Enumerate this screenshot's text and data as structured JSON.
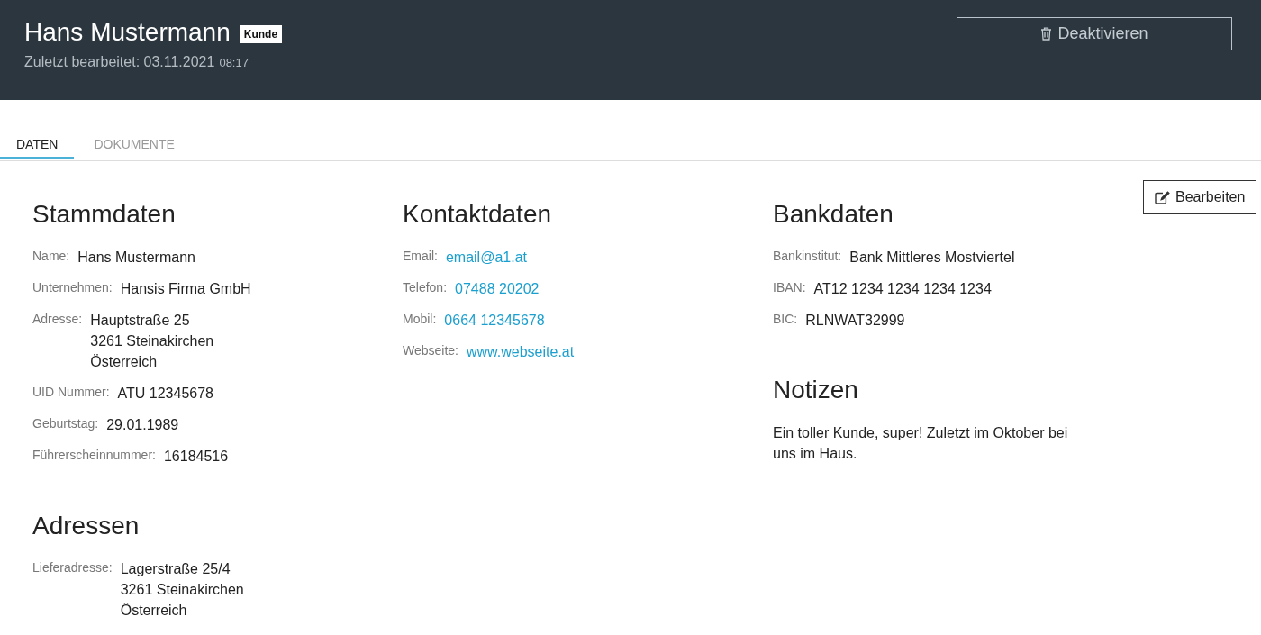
{
  "header": {
    "title": "Hans Mustermann",
    "badge": "Kunde",
    "edited_label": "Zuletzt bearbeitet: 03.11.2021",
    "edited_time": "08:17",
    "deactivate_button": "Deaktivieren"
  },
  "tabs": [
    {
      "label": "DATEN",
      "selected": true
    },
    {
      "label": "DOKUMENTE",
      "selected": false
    }
  ],
  "edit_button": "Bearbeiten",
  "columns": [
    {
      "sections": [
        {
          "title": "Stammdaten",
          "fields": [
            {
              "label": "Name:",
              "value": "Hans Mustermann",
              "kind": "text"
            },
            {
              "label": "Unternehmen:",
              "value": "Hansis Firma GmbH",
              "kind": "text"
            },
            {
              "label": "Adresse:",
              "value": "Hauptstraße 25\n3261 Steinakirchen\nÖsterreich",
              "kind": "text"
            },
            {
              "label": "UID Nummer:",
              "value": "ATU 12345678",
              "kind": "text"
            },
            {
              "label": "Geburtstag:",
              "value": "29.01.1989",
              "kind": "text"
            },
            {
              "label": "Führerscheinnummer:",
              "value": "16184516",
              "kind": "text"
            }
          ]
        },
        {
          "title": "Adressen",
          "fields": [
            {
              "label": "Lieferadresse:",
              "value": "Lagerstraße 25/4\n3261 Steinakirchen\nÖsterreich",
              "kind": "text"
            }
          ]
        }
      ]
    },
    {
      "sections": [
        {
          "title": "Kontaktdaten",
          "fields": [
            {
              "label": "Email:",
              "value": "email@a1.at",
              "kind": "link"
            },
            {
              "label": "Telefon:",
              "value": "07488 20202",
              "kind": "link"
            },
            {
              "label": "Mobil:",
              "value": "0664 12345678",
              "kind": "link"
            },
            {
              "label": "Webseite:",
              "value": "www.webseite.at",
              "kind": "link"
            }
          ]
        }
      ]
    },
    {
      "sections": [
        {
          "title": "Bankdaten",
          "fields": [
            {
              "label": "Bankinstitut:",
              "value": "Bank Mittleres Mostviertel",
              "kind": "text"
            },
            {
              "label": "IBAN:",
              "value": "AT12 1234 1234 1234 1234",
              "kind": "text"
            },
            {
              "label": "BIC:",
              "value": "RLNWAT32999",
              "kind": "text"
            }
          ]
        },
        {
          "title": "Notizen",
          "note": "Ein toller Kunde, super! Zuletzt im Oktober bei uns im Haus."
        }
      ]
    }
  ]
}
